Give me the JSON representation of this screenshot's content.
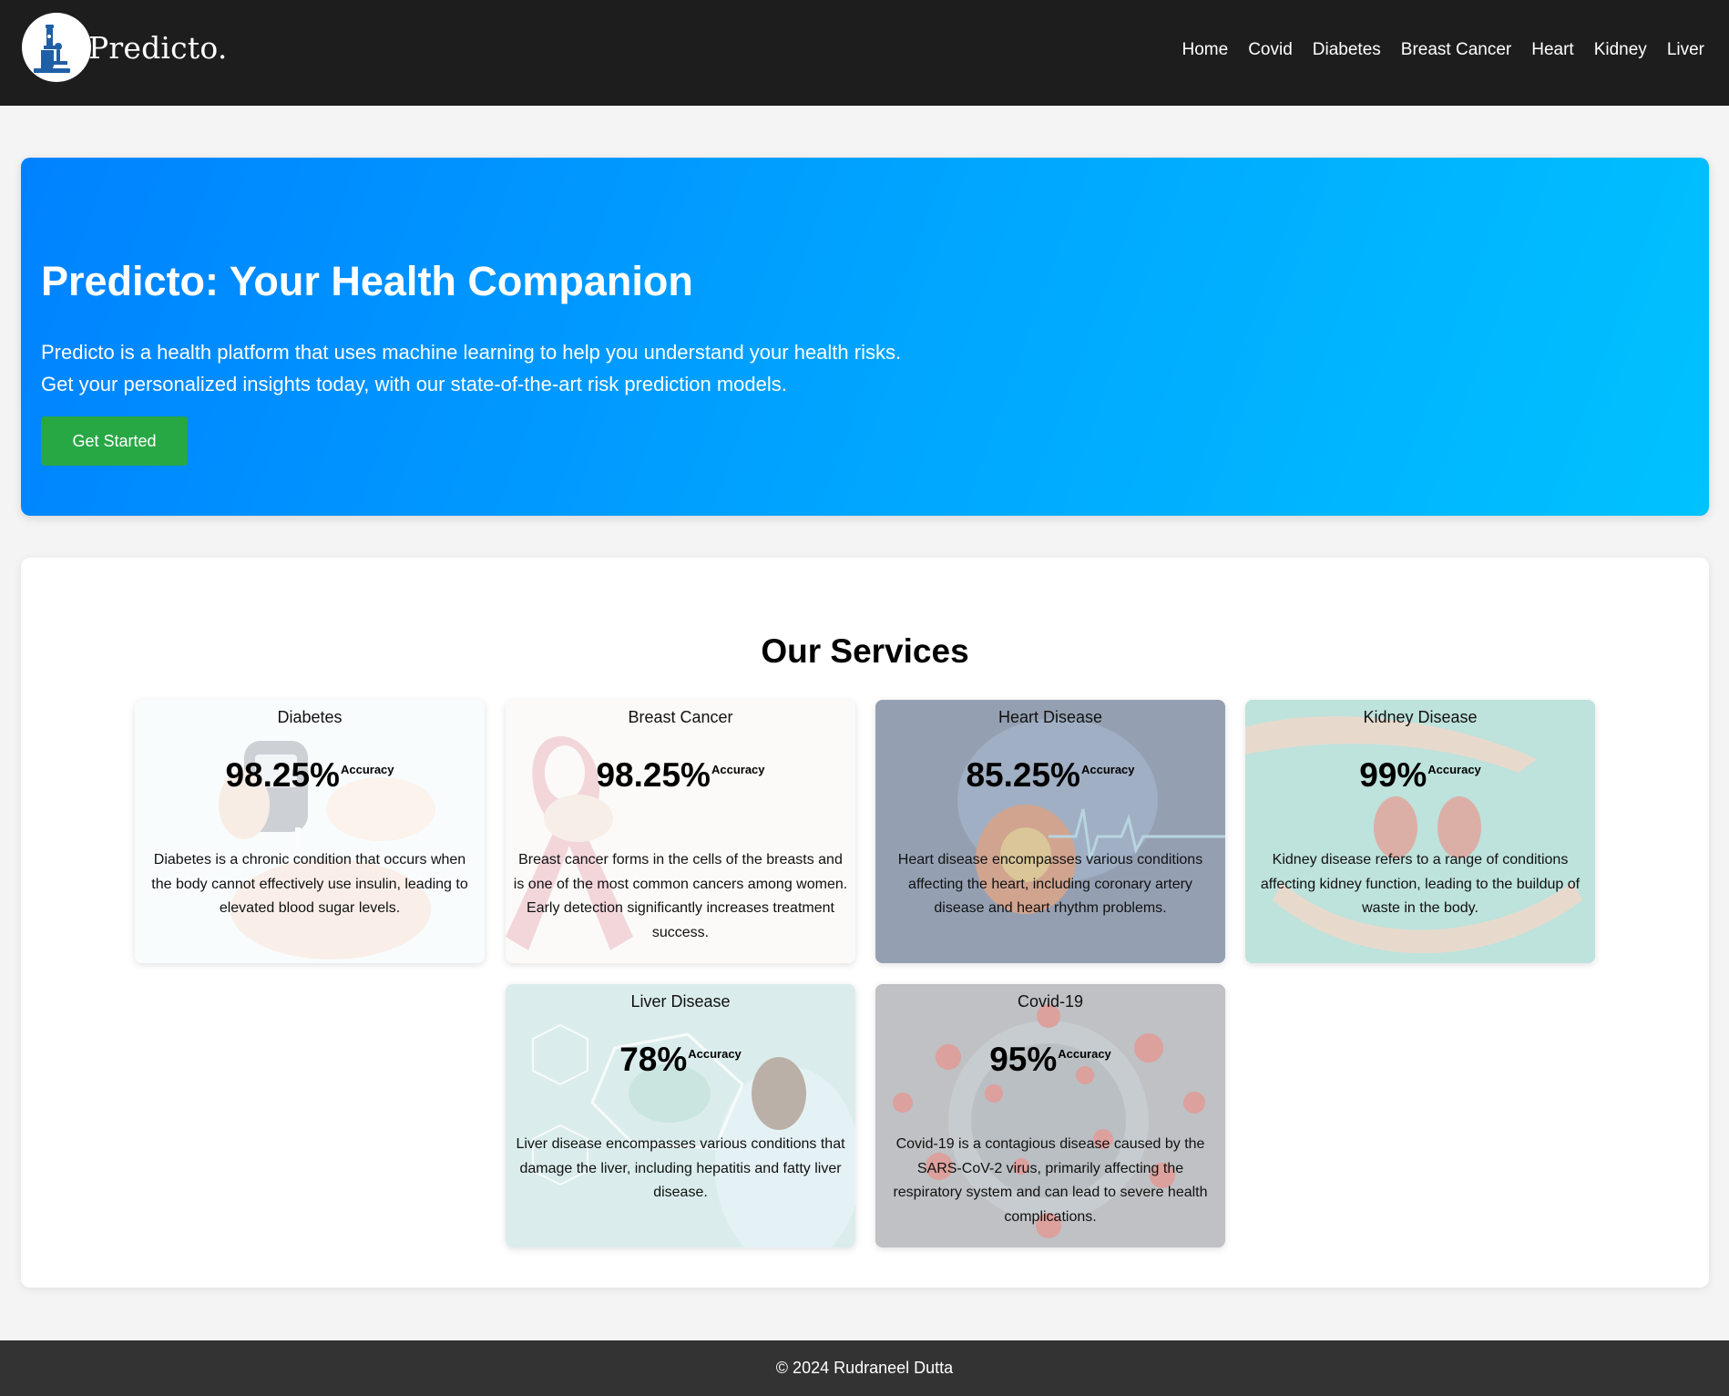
{
  "header": {
    "brand": "Predicto.",
    "nav": [
      "Home",
      "Covid",
      "Diabetes",
      "Breast Cancer",
      "Heart",
      "Kidney",
      "Liver"
    ]
  },
  "hero": {
    "title": "Predicto: Your Health Companion",
    "line1": "Predicto is a health platform that uses machine learning to help you understand your health risks.",
    "line2": "Get your personalized insights today, with our state-of-the-art risk prediction models.",
    "cta": "Get Started"
  },
  "services": {
    "title": "Our Services",
    "accuracy_label": "Accuracy",
    "cards": [
      {
        "title": "Diabetes",
        "accuracy": "98.25%",
        "description": "Diabetes is a chronic condition that occurs when the body cannot effectively use insulin, leading to elevated blood sugar levels."
      },
      {
        "title": "Breast Cancer",
        "accuracy": "98.25%",
        "description": "Breast cancer forms in the cells of the breasts and is one of the most common cancers among women. Early detection significantly increases treatment success."
      },
      {
        "title": "Heart Disease",
        "accuracy": "85.25%",
        "description": "Heart disease encompasses various conditions affecting the heart, including coronary artery disease and heart rhythm problems."
      },
      {
        "title": "Kidney Disease",
        "accuracy": "99%",
        "description": "Kidney disease refers to a range of conditions affecting kidney function, leading to the buildup of waste in the body."
      },
      {
        "title": "Liver Disease",
        "accuracy": "78%",
        "description": "Liver disease encompasses various conditions that damage the liver, including hepatitis and fatty liver disease."
      },
      {
        "title": "Covid-19",
        "accuracy": "95%",
        "description": "Covid-19 is a contagious disease caused by the SARS-CoV-2 virus, primarily affecting the respiratory system and can lead to severe health complications."
      }
    ]
  },
  "footer": {
    "text": "© 2024 Rudraneel Dutta"
  },
  "colors": {
    "header_bg": "#1d1d1d",
    "hero_gradient_start": "#0082ff",
    "hero_gradient_end": "#00c2ff",
    "cta_bg": "#28a745",
    "footer_bg": "#333333"
  }
}
